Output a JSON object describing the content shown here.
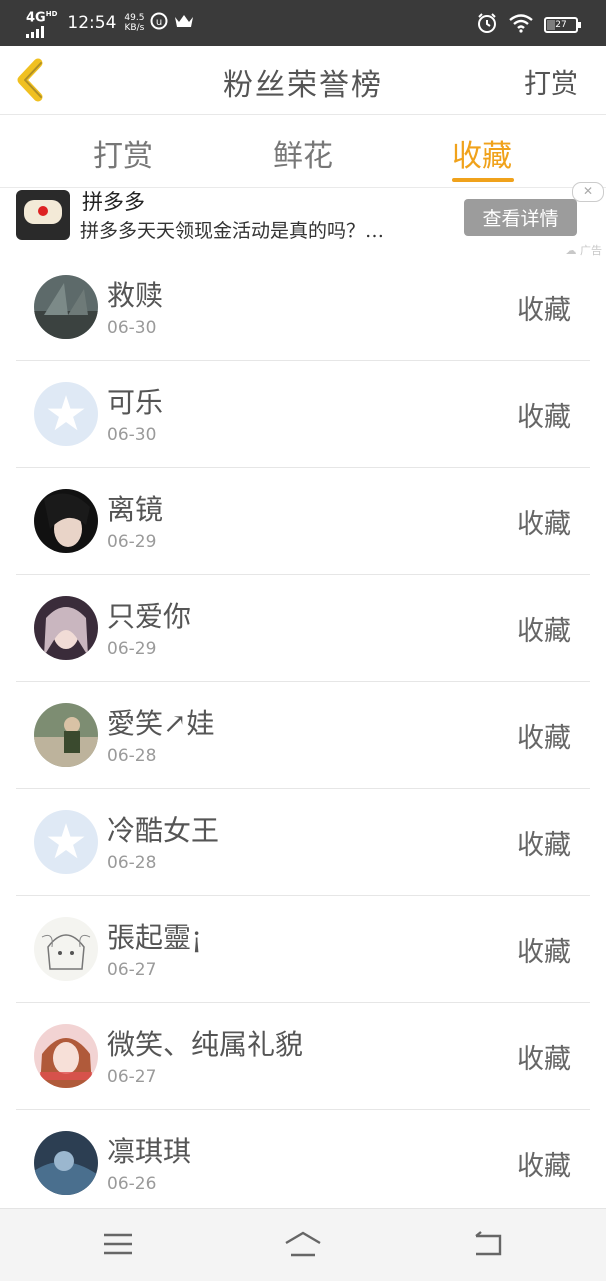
{
  "status_bar": {
    "network": "4G",
    "network_sup": "HD",
    "time": "12:54",
    "speed_value": "49.5",
    "speed_unit": "KB/s",
    "battery": "27",
    "icons": [
      "signal-icon",
      "app-icon",
      "crown-icon",
      "alarm-icon",
      "wifi-icon",
      "battery-icon"
    ]
  },
  "header": {
    "back_icon": "chevron-left-icon",
    "title": "粉丝荣誉榜",
    "right_action": "打赏"
  },
  "tabs": {
    "items": [
      "打赏",
      "鲜花",
      "收藏"
    ],
    "active": "收藏"
  },
  "ad": {
    "name": "拼多多",
    "text": "拼多多天天领现金活动是真的吗？…",
    "button": "查看详情",
    "label": "广告"
  },
  "fans": [
    {
      "name": "救赎",
      "date": "06-30",
      "action": "收藏"
    },
    {
      "name": "可乐",
      "date": "06-30",
      "action": "收藏"
    },
    {
      "name": "离镜",
      "date": "06-29",
      "action": "收藏"
    },
    {
      "name": "只爱你",
      "date": "06-29",
      "action": "收藏"
    },
    {
      "name": "愛笑↗娃",
      "date": "06-28",
      "action": "收藏"
    },
    {
      "name": "冷酷女王",
      "date": "06-28",
      "action": "收藏"
    },
    {
      "name": "張起靈¡",
      "date": "06-27",
      "action": "收藏"
    },
    {
      "name": "微笑、纯属礼貌",
      "date": "06-27",
      "action": "收藏"
    },
    {
      "name": "凛琪琪",
      "date": "06-26",
      "action": "收藏"
    }
  ],
  "nav": {
    "menu_icon": "menu-icon",
    "home_icon": "home-icon",
    "back_icon": "back-icon"
  },
  "colors": {
    "accent": "#f0a21b",
    "status_bar": "#3a3a3a",
    "text": "#555555"
  }
}
